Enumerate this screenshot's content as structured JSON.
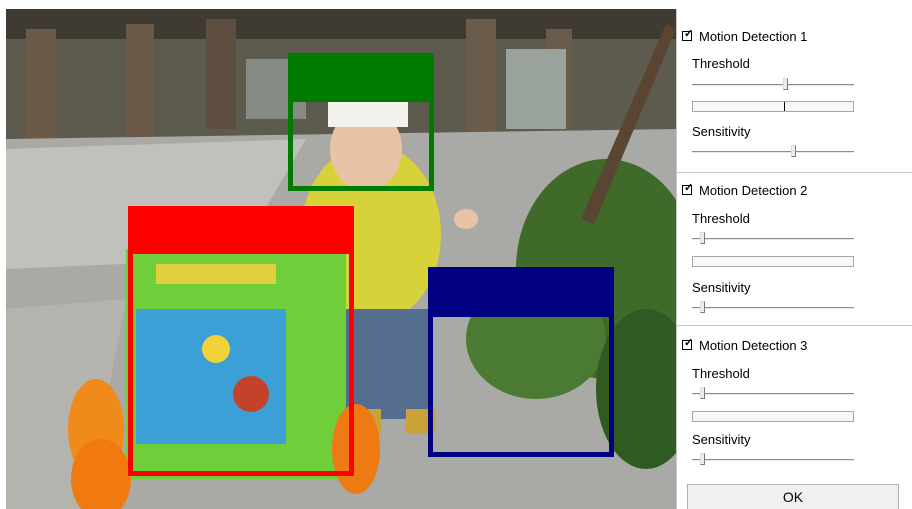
{
  "colors": {
    "zone1": "#007a00",
    "zone2": "#ff0000",
    "zone3": "#000080"
  },
  "video": {
    "scene_description_icon": "camera-feed-image"
  },
  "panel": {
    "sections": [
      {
        "enabled": true,
        "label": "Motion Detection 1",
        "threshold_label": "Threshold",
        "threshold_value": 0.58,
        "level_value": 0.57,
        "sensitivity_label": "Sensitivity",
        "sensitivity_value": 0.63
      },
      {
        "enabled": true,
        "label": "Motion Detection 2",
        "threshold_label": "Threshold",
        "threshold_value": 0.05,
        "level_value": 0.0,
        "sensitivity_label": "Sensitivity",
        "sensitivity_value": 0.05
      },
      {
        "enabled": true,
        "label": "Motion Detection 3",
        "threshold_label": "Threshold",
        "threshold_value": 0.05,
        "level_value": 0.0,
        "sensitivity_label": "Sensitivity",
        "sensitivity_value": 0.05
      }
    ],
    "ok_label": "OK"
  }
}
